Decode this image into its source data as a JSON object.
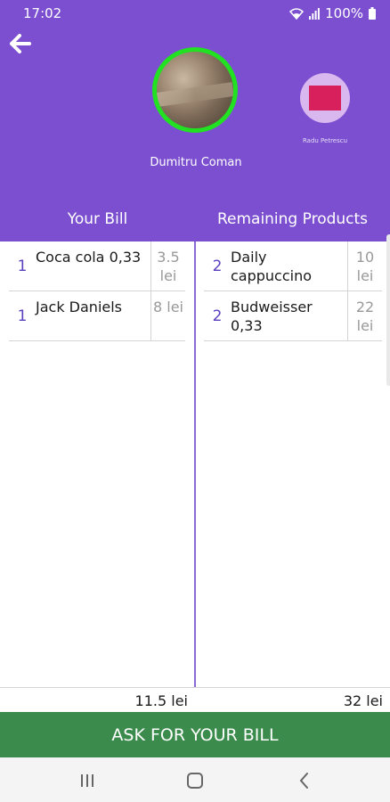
{
  "status": {
    "time": "17:02",
    "battery": "100%"
  },
  "icons": {
    "back": "arrow-left-icon",
    "wifi": "wifi-icon",
    "signal": "signal-icon",
    "battery": "battery-icon",
    "recents": "recents-icon",
    "home": "home-icon",
    "nav_back": "chevron-left-icon"
  },
  "colors": {
    "header": "#7b4fd0",
    "active_ring": "#22e022",
    "button": "#3b8c4c",
    "accent_text": "#5a3fbf"
  },
  "users": {
    "main_name": "Dumitru Coman",
    "other_name": "Radu Petrescu"
  },
  "columns": {
    "left_title": "Your Bill",
    "right_title": "Remaining Products"
  },
  "your_bill": [
    {
      "qty": "1",
      "name": "Coca cola 0,33",
      "price": "3.5 lei"
    },
    {
      "qty": "1",
      "name": "Jack Daniels",
      "price": "8 lei"
    }
  ],
  "remaining": [
    {
      "qty": "2",
      "name": "Daily cappuccino",
      "price": "10 lei"
    },
    {
      "qty": "2",
      "name": "Budweisser 0,33",
      "price": "22 lei"
    }
  ],
  "totals": {
    "left": "11.5 lei",
    "right": "32 lei"
  },
  "button": {
    "label": "ASK FOR YOUR BILL"
  }
}
